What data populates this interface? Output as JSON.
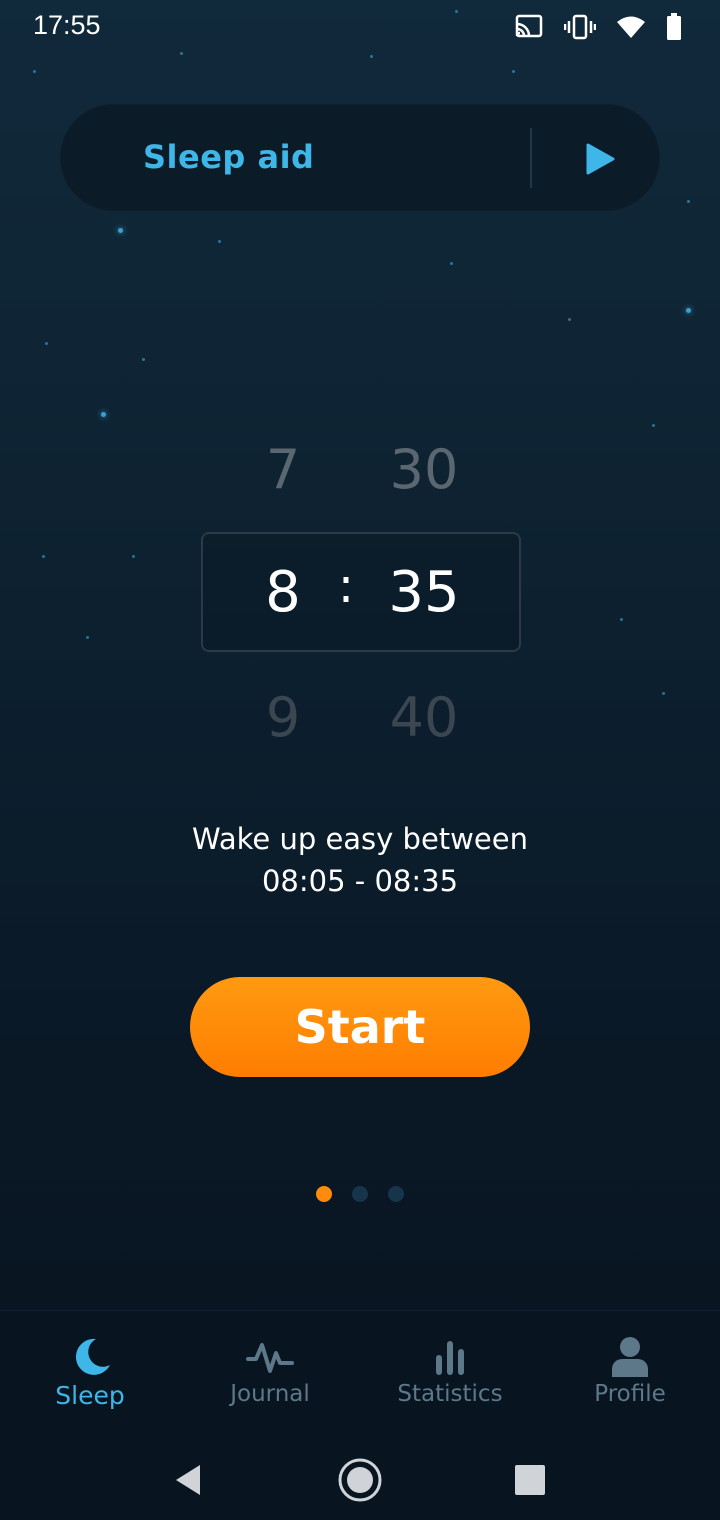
{
  "status_bar": {
    "time": "17:55",
    "icons": [
      "cast-icon",
      "vibrate-icon",
      "wifi-icon",
      "battery-icon"
    ]
  },
  "sleep_aid": {
    "label": "Sleep aid",
    "play_icon": "play-icon"
  },
  "time_picker": {
    "hours": {
      "above": "7",
      "selected": "8",
      "below": "9"
    },
    "minutes": {
      "above": "30",
      "selected": "35",
      "below": "40"
    },
    "separator": ":"
  },
  "wake_window": {
    "line1": "Wake up easy between",
    "line2": "08:05 - 08:35"
  },
  "start_button": {
    "label": "Start"
  },
  "pager": {
    "count": 3,
    "active_index": 0
  },
  "tabs": [
    {
      "label": "Sleep",
      "icon": "moon-icon",
      "active": true
    },
    {
      "label": "Journal",
      "icon": "pulse-icon",
      "active": false
    },
    {
      "label": "Statistics",
      "icon": "bar-chart-icon",
      "active": false
    },
    {
      "label": "Profile",
      "icon": "person-icon",
      "active": false
    }
  ],
  "nav_bar": [
    "back-icon",
    "home-icon",
    "recents-icon"
  ],
  "colors": {
    "accent": "#3fb6e8",
    "start": "#ff8b0a",
    "background": "#0c1f2e"
  }
}
